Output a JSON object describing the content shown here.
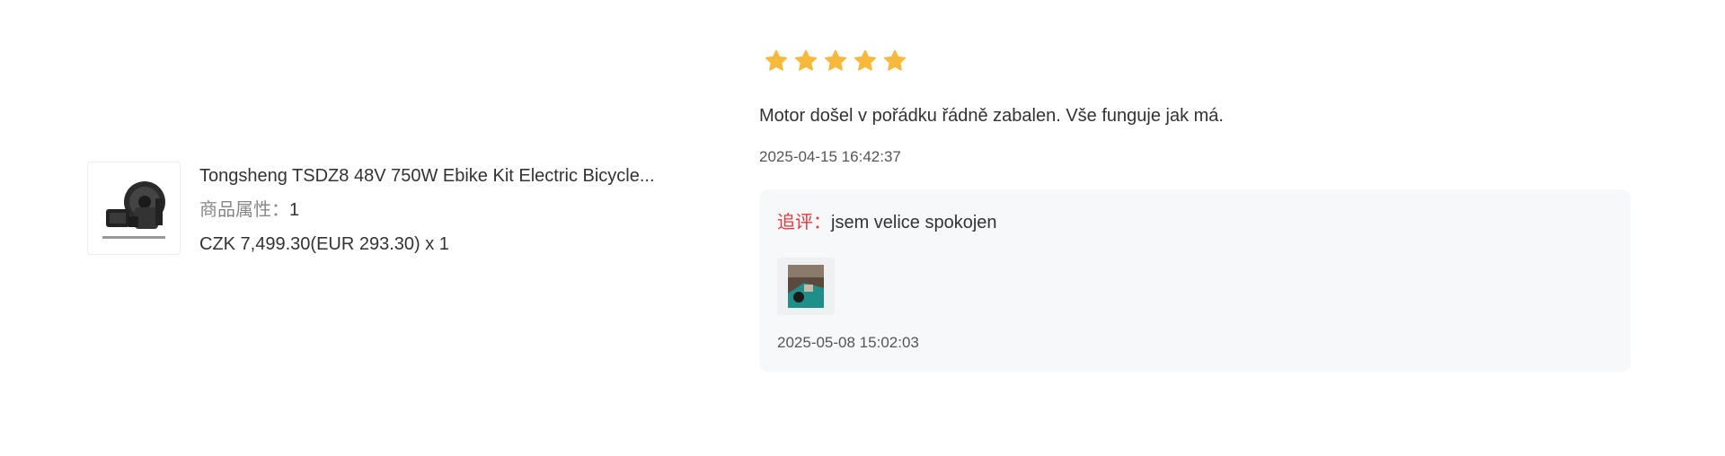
{
  "product": {
    "image_icon": "ebike-kit-icon",
    "name": "Tongsheng TSDZ8 48V 750W Ebike Kit Electric Bicycle...",
    "attr_label": "商品属性：",
    "attr_value": "1",
    "price": "CZK 7,499.30(EUR 293.30) x 1"
  },
  "review": {
    "rating": 5,
    "rating_max": 5,
    "star_color": "#f6b93b",
    "text": "Motor došel v pořádku řádně zabalen. Vše funguje jak má.",
    "time": "2025-04-15 16:42:37"
  },
  "followup": {
    "label": "追评：",
    "label_color": "#e4393c",
    "text": "jsem velice spokojen",
    "photo_icon": "review-photo-icon",
    "time": "2025-05-08 15:02:03"
  }
}
